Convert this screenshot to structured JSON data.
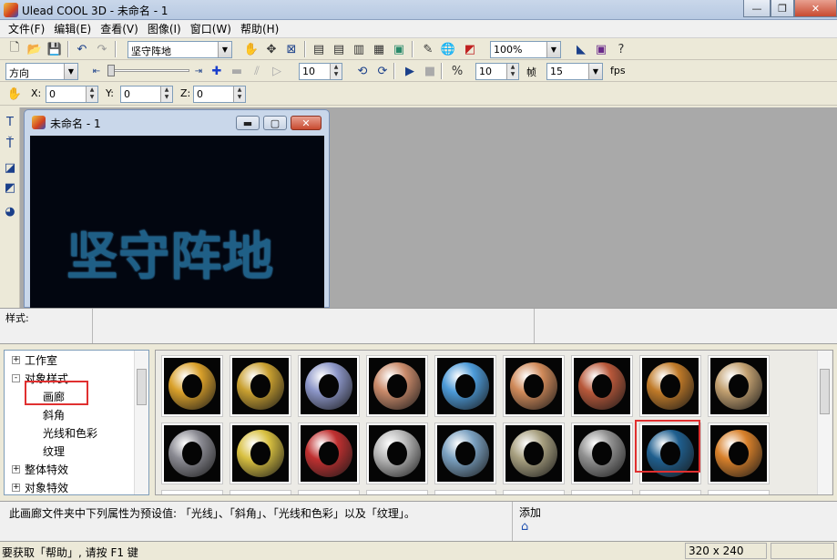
{
  "window": {
    "title": "Ulead COOL 3D - 未命名 - 1",
    "minimize": "—",
    "maximize": "❐",
    "close": "✕"
  },
  "menu": [
    "文件(F)",
    "编辑(E)",
    "查看(V)",
    "图像(I)",
    "窗口(W)",
    "帮助(H)"
  ],
  "toolbar1": {
    "text_combo": "坚守阵地",
    "zoom_combo": "100%"
  },
  "toolbar2": {
    "direction_combo": "方向",
    "spin1": "10",
    "spin2": "10",
    "frame_label": "帧",
    "frames_combo": "15",
    "fps_label": "fps"
  },
  "toolbar3": {
    "x_label": "X:",
    "x_value": "0",
    "y_label": "Y:",
    "y_value": "0",
    "z_label": "Z:",
    "z_value": "0"
  },
  "document": {
    "title": "未命名 - 1",
    "canvas_text": "坚守阵地"
  },
  "stylebar": {
    "label": "样式:"
  },
  "tree": {
    "items": [
      {
        "label": "工作室",
        "expander": "+"
      },
      {
        "label": "对象样式",
        "expander": "-"
      },
      {
        "label": "画廊"
      },
      {
        "label": "斜角"
      },
      {
        "label": "光线和色彩"
      },
      {
        "label": "纹理"
      },
      {
        "label": "整体特效",
        "expander": "+"
      },
      {
        "label": "对象特效",
        "expander": "+"
      }
    ]
  },
  "gallery": {
    "row1_colors": [
      "#d9a02a",
      "#c9a030",
      "#8c96c8",
      "#c98a6a",
      "#4c9ad8",
      "#d08a5a",
      "#b8583a",
      "#c07a28",
      "#c2a070"
    ],
    "row2_colors": [
      "#8a8a92",
      "#d8c040",
      "#c03030",
      "#b8b8b8",
      "#7aa0c0",
      "#a8a080",
      "#909090",
      "#1f5f8f",
      "#d8802a"
    ]
  },
  "description": {
    "text": "此画廊文件夹中下列属性为预设值: 「光线」、「斜角」、「光线和色彩」以及「纹理」。",
    "add_label": "添加"
  },
  "status": {
    "help": "要获取「帮助」, 请按 F1 键",
    "size": "320 x 240"
  }
}
